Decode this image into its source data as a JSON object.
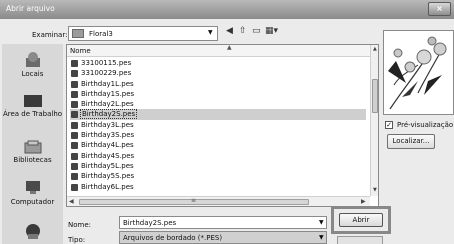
{
  "window": {
    "title": "Abrir arquivo",
    "close_glyph": "×"
  },
  "lookin": {
    "label": "Examinar:",
    "value": "Floral3"
  },
  "places": [
    {
      "label": "Locais",
      "icon": "recent-places-icon"
    },
    {
      "label": "Área de Trabalho",
      "icon": "desktop-icon"
    },
    {
      "label": "Bibliotecas",
      "icon": "libraries-icon"
    },
    {
      "label": "Computador",
      "icon": "computer-icon"
    },
    {
      "label": "",
      "icon": "network-icon"
    }
  ],
  "list": {
    "column_name": "Nome",
    "files": [
      "33100115.pes",
      "33100229.pes",
      "Birthday1L.pes",
      "Birthday1S.pes",
      "Birthday2L.pes",
      "Birthday2S.pes",
      "Birthday3L.pes",
      "Birthday3S.pes",
      "Birthday4L.pes",
      "Birthday4S.pes",
      "Birthday5L.pes",
      "Birthday5S.pes",
      "Birthday6L.pes"
    ],
    "selected_index": 5
  },
  "preview": {
    "checkbox_label": "Pré-visualização",
    "checked": true,
    "locate_label": "Localizar..."
  },
  "filename": {
    "label": "Nome:",
    "value": "Birthday2S.pes"
  },
  "filetype": {
    "label": "Tipo:",
    "value": "Arquivos de bordado (*.PES)"
  },
  "buttons": {
    "open_label": "Abrir"
  },
  "colors": {
    "titlebar": "#9a9a9a",
    "selection": "#cfcfcf",
    "highlight_border": "#888888"
  }
}
